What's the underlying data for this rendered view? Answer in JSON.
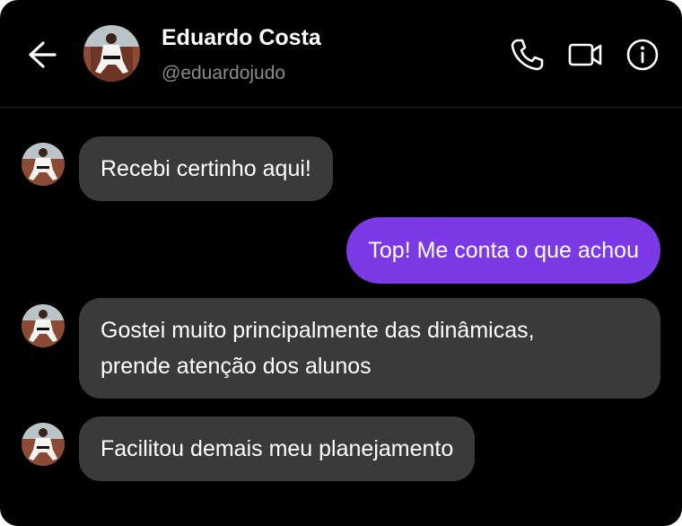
{
  "header": {
    "contact_name": "Eduardo Costa",
    "contact_handle": "@eduardojudo"
  },
  "icons": {
    "back": "arrow-left-icon",
    "call": "phone-icon",
    "video": "video-camera-icon",
    "info": "info-icon"
  },
  "colors": {
    "background": "#000000",
    "incoming_bubble": "#3a3a3a",
    "outgoing_bubble": "#7c3ae6",
    "handle_text": "#8a8a8a"
  },
  "messages": [
    {
      "direction": "incoming",
      "lines": [
        "Recebi certinho aqui!"
      ]
    },
    {
      "direction": "outgoing",
      "lines": [
        "Top! Me conta o que achou"
      ]
    },
    {
      "direction": "incoming",
      "lines": [
        "Gostei muito principalmente das dinâmicas,",
        "prende atenção dos alunos"
      ]
    },
    {
      "direction": "incoming",
      "lines": [
        "Facilitou demais meu planejamento"
      ]
    }
  ]
}
